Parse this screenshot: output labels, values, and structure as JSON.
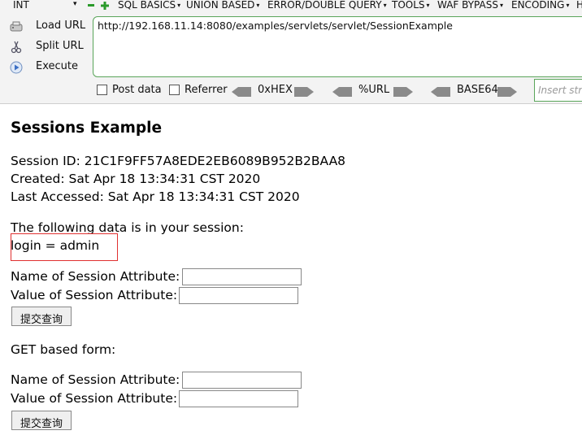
{
  "hackbar": {
    "menu": {
      "int": "INT",
      "sql_basics": "SQL BASICS",
      "union_based": "UNION BASED",
      "error_double_query": "ERROR/DOUBLE QUERY",
      "tools": "TOOLS",
      "waf_bypass": "WAF BYPASS",
      "encoding": "ENCODING",
      "html": "H"
    },
    "load_url": "Load URL",
    "split_url": "Split URL",
    "execute": "Execute",
    "url_value": "http://192.168.11.14:8080/examples/servlets/servlet/SessionExample",
    "post_data": "Post data",
    "referrer": "Referrer",
    "hex": "0xHEX",
    "url_enc": "%URL",
    "base64": "BASE64",
    "insert_placeholder": "Insert stri"
  },
  "page": {
    "title": "Sessions Example",
    "session_id": "Session ID: 21C1F9FF57A8EDE2EB6089B952B2BAA8",
    "created": "Created: Sat Apr 18 13:34:31 CST 2020",
    "last_accessed": "Last Accessed: Sat Apr 18 13:34:31 CST 2020",
    "session_data_heading": "The following data is in your session:",
    "session_entry": "login = admin",
    "post_form": {
      "name_label": "Name of Session Attribute:",
      "value_label": "Value of Session Attribute:",
      "submit": "提交查询"
    },
    "get_form_heading": "GET based form:",
    "get_form": {
      "name_label": "Name of Session Attribute:",
      "value_label": "Value of Session Attribute:",
      "submit": "提交查询"
    }
  }
}
